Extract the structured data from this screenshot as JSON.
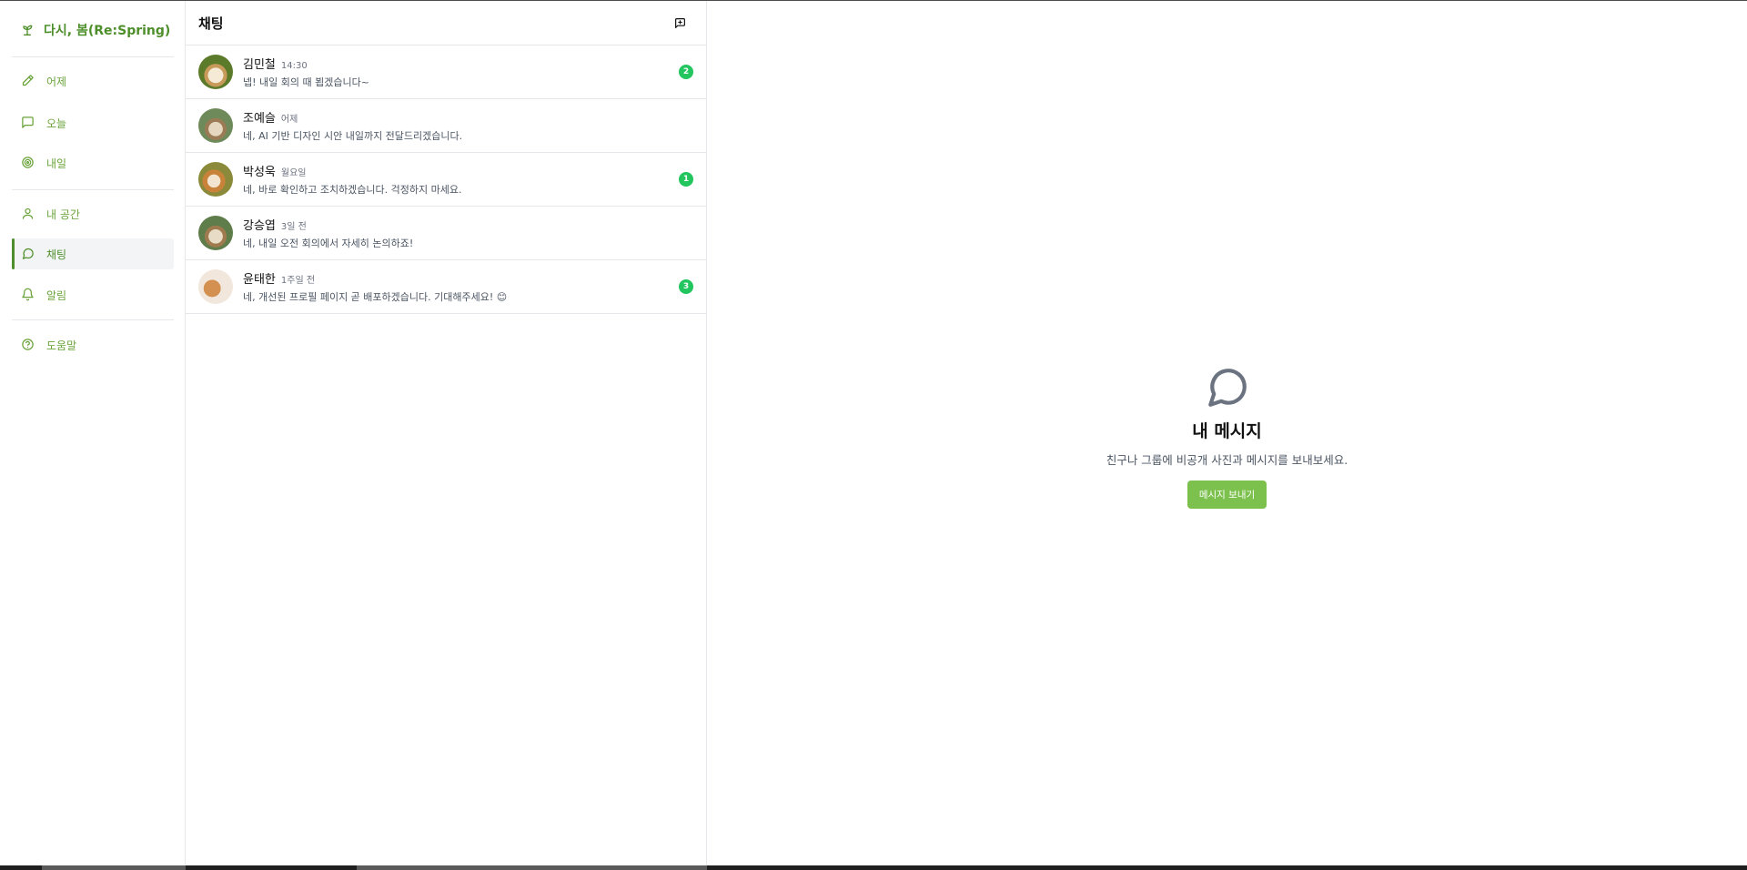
{
  "brand": {
    "name": "다시, 봄(Re:Spring)"
  },
  "sidebar": {
    "items": [
      {
        "label": "어제",
        "icon": "pencil-icon"
      },
      {
        "label": "오늘",
        "icon": "message-square-icon"
      },
      {
        "label": "내일",
        "icon": "target-icon"
      },
      {
        "label": "내 공간",
        "icon": "user-icon"
      },
      {
        "label": "채팅",
        "icon": "message-circle-icon",
        "active": true
      },
      {
        "label": "알림",
        "icon": "bell-icon"
      },
      {
        "label": "도움말",
        "icon": "help-circle-icon"
      }
    ]
  },
  "chatlist": {
    "title": "채팅",
    "new_chat_icon": "message-plus-icon",
    "chats": [
      {
        "name": "김민철",
        "time": "14:30",
        "message": "넵! 내일 회의 때 뵙겠습니다~",
        "unread": "2"
      },
      {
        "name": "조예슬",
        "time": "어제",
        "message": "네, AI 기반 디자인 시안 내일까지 전달드리겠습니다.",
        "unread": ""
      },
      {
        "name": "박성욱",
        "time": "월요일",
        "message": "네, 바로 확인하고 조치하겠습니다. 걱정하지 마세요.",
        "unread": "1"
      },
      {
        "name": "강승엽",
        "time": "3일 전",
        "message": "네, 내일 오전 회의에서 자세히 논의하죠!",
        "unread": ""
      },
      {
        "name": "윤태한",
        "time": "1주일 전",
        "message": "네, 개선된 프로필 페이지 곧 배포하겠습니다. 기대해주세요! 😊",
        "unread": "3"
      }
    ]
  },
  "main": {
    "empty_title": "내 메시지",
    "empty_subtitle": "친구나 그룹에 비공개 사진과 메시지를 보내보세요.",
    "send_button": "메시지 보내기"
  },
  "colors": {
    "brand": "#4e8f2b",
    "nav_text": "#6aa33a",
    "badge": "#22c55e",
    "button": "#7cc14e"
  }
}
